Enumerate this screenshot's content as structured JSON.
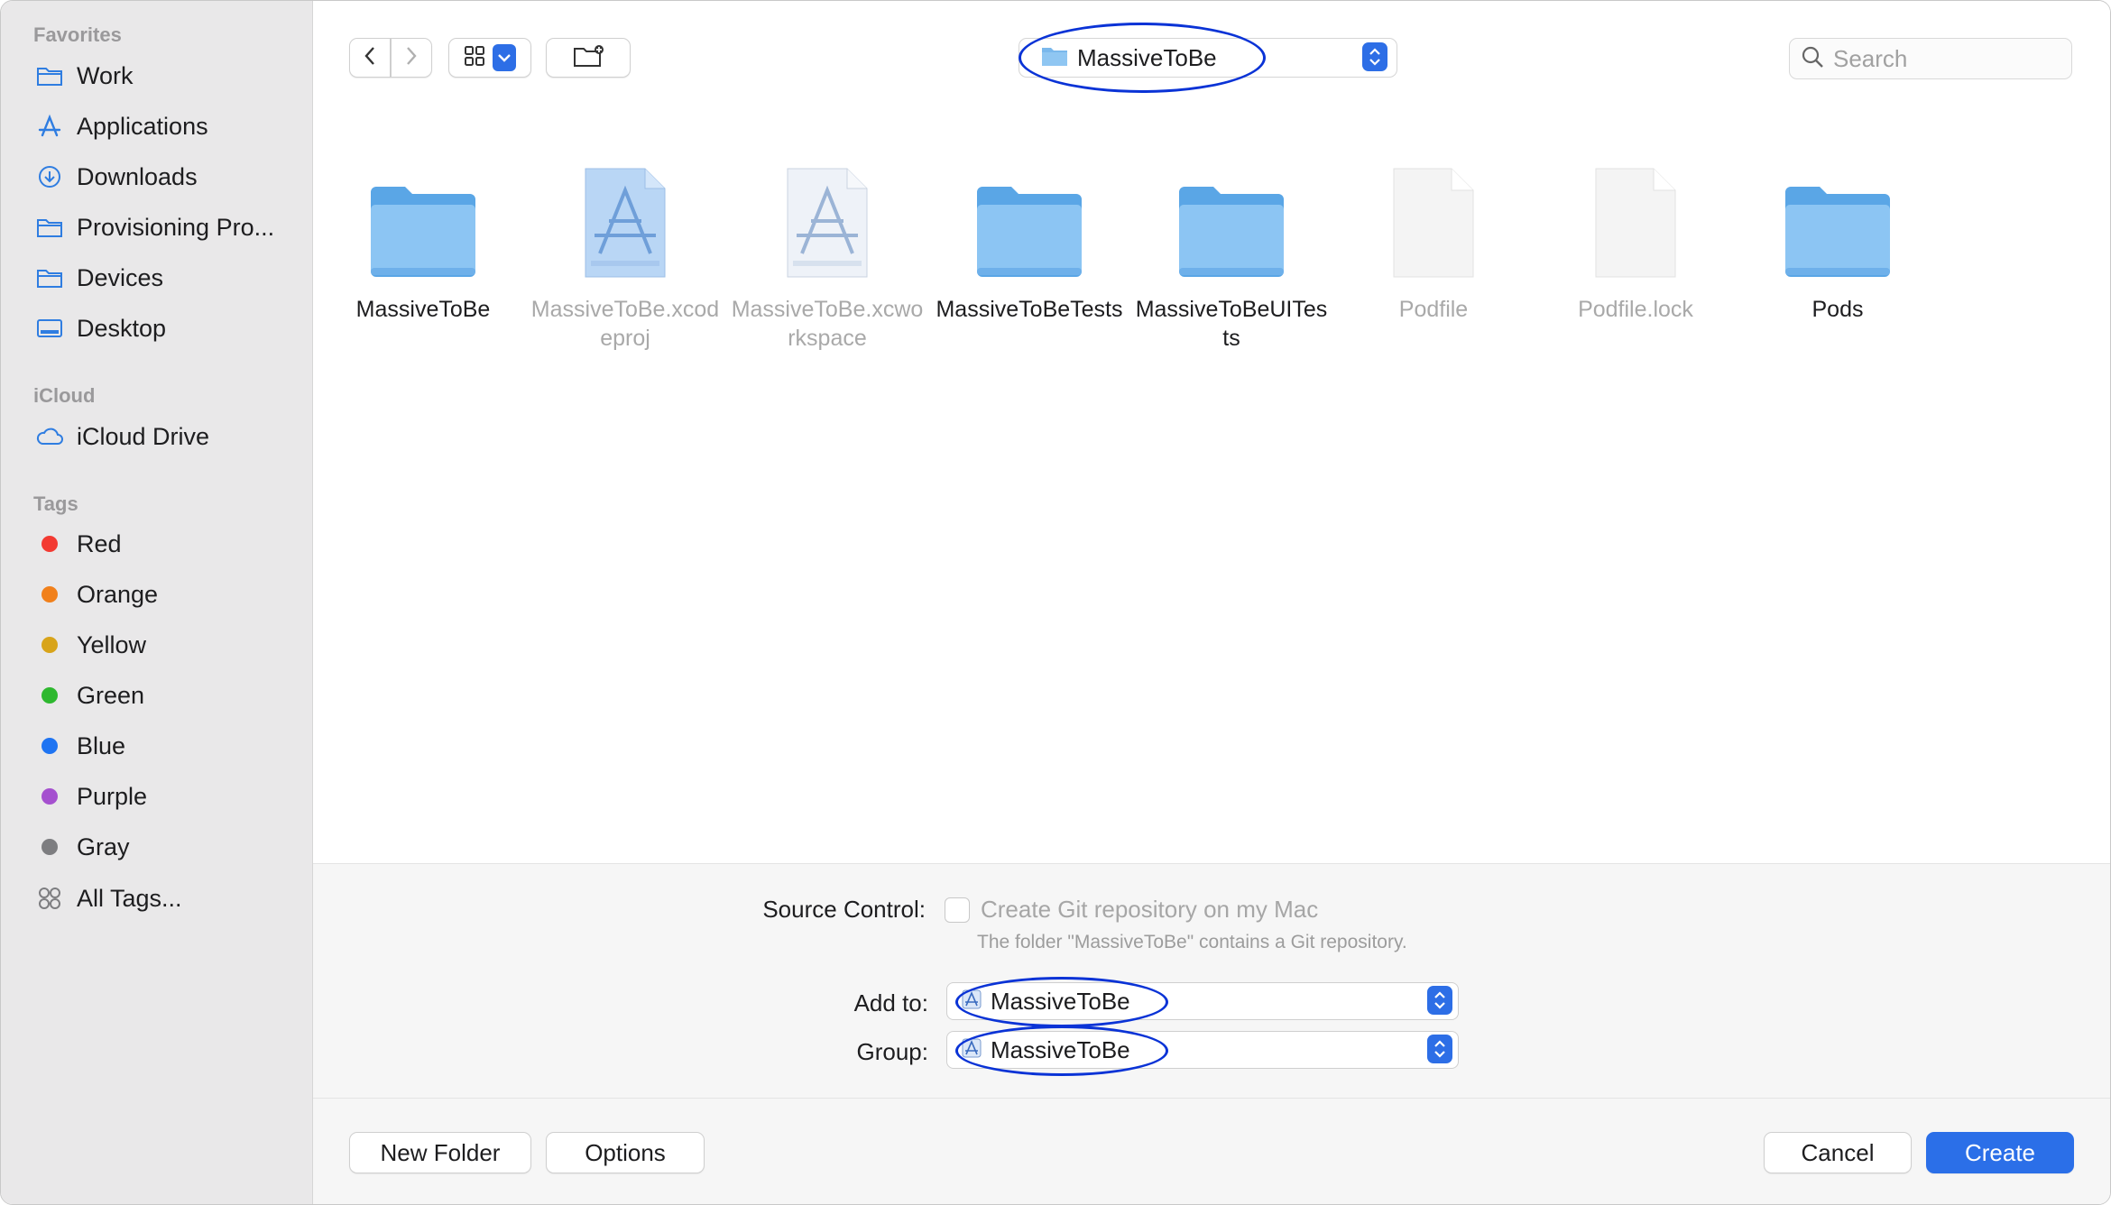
{
  "sidebar": {
    "favorites_title": "Favorites",
    "favorites": [
      {
        "label": "Work",
        "icon": "folder-icon"
      },
      {
        "label": "Applications",
        "icon": "applications-icon"
      },
      {
        "label": "Downloads",
        "icon": "downloads-icon"
      },
      {
        "label": "Provisioning Pro...",
        "icon": "folder-icon"
      },
      {
        "label": "Devices",
        "icon": "folder-icon"
      },
      {
        "label": "Desktop",
        "icon": "desktop-icon"
      }
    ],
    "icloud_title": "iCloud",
    "icloud": [
      {
        "label": "iCloud Drive",
        "icon": "cloud-icon"
      }
    ],
    "tags_title": "Tags",
    "tags": [
      {
        "label": "Red",
        "color": "#f33a32"
      },
      {
        "label": "Orange",
        "color": "#f1801b"
      },
      {
        "label": "Yellow",
        "color": "#d8a41a"
      },
      {
        "label": "Green",
        "color": "#2eb82f"
      },
      {
        "label": "Blue",
        "color": "#1f74f2"
      },
      {
        "label": "Purple",
        "color": "#a550cf"
      },
      {
        "label": "Gray",
        "color": "#7d7d80"
      }
    ],
    "all_tags": "All Tags..."
  },
  "toolbar": {
    "back_icon": "chevron-left-icon",
    "forward_icon": "chevron-right-icon",
    "view_icon": "grid-view-icon",
    "new_folder_icon": "new-folder-icon",
    "location": "MassiveToBe",
    "search_placeholder": "Search"
  },
  "files": [
    {
      "name": "MassiveToBe",
      "kind": "folder",
      "dim": false
    },
    {
      "name": "MassiveToBe.xcodeproj",
      "kind": "xcodeproj",
      "dim": true
    },
    {
      "name": "MassiveToBe.xcworkspace",
      "kind": "xcworkspace",
      "dim": true
    },
    {
      "name": "MassiveToBeTests",
      "kind": "folder",
      "dim": false
    },
    {
      "name": "MassiveToBeUITests",
      "kind": "folder",
      "dim": false
    },
    {
      "name": "Podfile",
      "kind": "document",
      "dim": true
    },
    {
      "name": "Podfile.lock",
      "kind": "document",
      "dim": true
    },
    {
      "name": "Pods",
      "kind": "folder",
      "dim": false
    }
  ],
  "options": {
    "source_control_label": "Source Control:",
    "git_checkbox_label": "Create Git repository on my Mac",
    "git_note": "The folder \"MassiveToBe\" contains a Git repository.",
    "add_to_label": "Add to:",
    "add_to_value": "MassiveToBe",
    "group_label": "Group:",
    "group_value": "MassiveToBe"
  },
  "buttons": {
    "new_folder": "New Folder",
    "options": "Options",
    "cancel": "Cancel",
    "create": "Create"
  },
  "colors": {
    "accent": "#2b6fe8",
    "annotation": "#0a33d6"
  }
}
